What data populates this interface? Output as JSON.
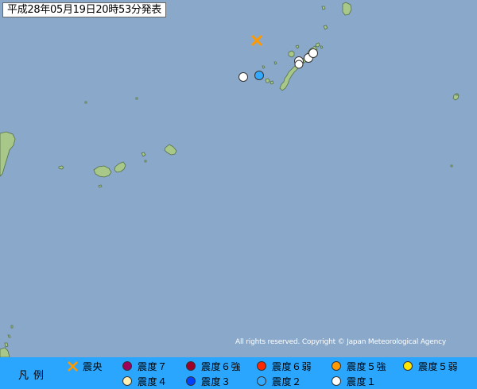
{
  "title": "平成28年05月19日20時53分発表",
  "credit": "All rights reserved. Copyright © Japan Meteorological Agency",
  "colors": {
    "sea": "#8aa8c9",
    "land": "#a8c88a",
    "legend_bg": "#2aa6ff",
    "epicenter": "#ff9900"
  },
  "map_markers": [
    {
      "type": "epicenter",
      "name": "epicenter-marker"
    },
    {
      "type": "intensity-2",
      "color": "#33aaff"
    },
    {
      "type": "intensity-1",
      "color": "#ffffff"
    },
    {
      "type": "intensity-1",
      "color": "#ffffff"
    },
    {
      "type": "intensity-1",
      "color": "#ffffff"
    },
    {
      "type": "intensity-1",
      "color": "#ffffff"
    },
    {
      "type": "intensity-1",
      "color": "#ffffff"
    }
  ],
  "legend": {
    "title": "凡例",
    "items": [
      {
        "label": "震央",
        "symbol": "cross-icon",
        "color": "#ff9900"
      },
      {
        "label": "震度７",
        "symbol": "dot",
        "color": "#a0005a"
      },
      {
        "label": "震度６強",
        "symbol": "dot",
        "color": "#a00028"
      },
      {
        "label": "震度６弱",
        "symbol": "dot",
        "color": "#ff2800"
      },
      {
        "label": "震度５強",
        "symbol": "dot",
        "color": "#ff9900"
      },
      {
        "label": "震度５弱",
        "symbol": "dot",
        "color": "#ffe600"
      },
      {
        "label": "震度４",
        "symbol": "dot",
        "color": "#fff0b4"
      },
      {
        "label": "震度３",
        "symbol": "dot",
        "color": "#0041ff"
      },
      {
        "label": "震度２",
        "symbol": "dot",
        "color": "#33aaff"
      },
      {
        "label": "震度１",
        "symbol": "dot",
        "color": "#ffffff"
      }
    ]
  }
}
